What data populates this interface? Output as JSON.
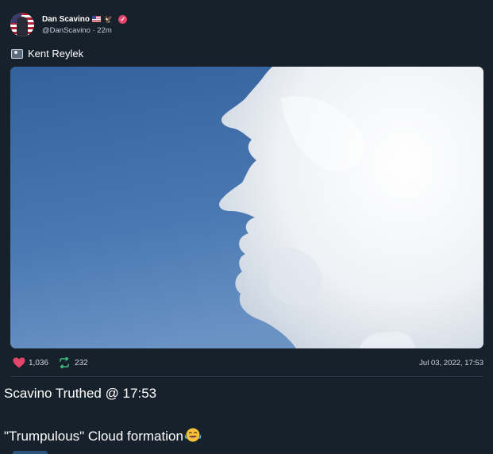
{
  "author": {
    "name": "Dan Scavino",
    "name_emojis": [
      "us-flag-icon",
      "eagle-icon"
    ],
    "handle_time": "@DanScavino · 22m",
    "verified_icon": "verified-badge-icon"
  },
  "post": {
    "source_label": "Kent Reylek",
    "source_icon": "camera-icon",
    "stats": {
      "likes": "1,036",
      "reposts": "232"
    },
    "timestamp": "Jul 03, 2022, 17:53"
  },
  "message": {
    "line1": "Scavino Truthed @ 17:53",
    "line2": "\"Trumpulous\" Cloud formation",
    "line2_emoji": "face-with-tears-of-joy-icon"
  },
  "colors": {
    "background": "#17212b",
    "heart": "#e3456b",
    "repost": "#3fbf7f",
    "verified": "#e3456b"
  }
}
